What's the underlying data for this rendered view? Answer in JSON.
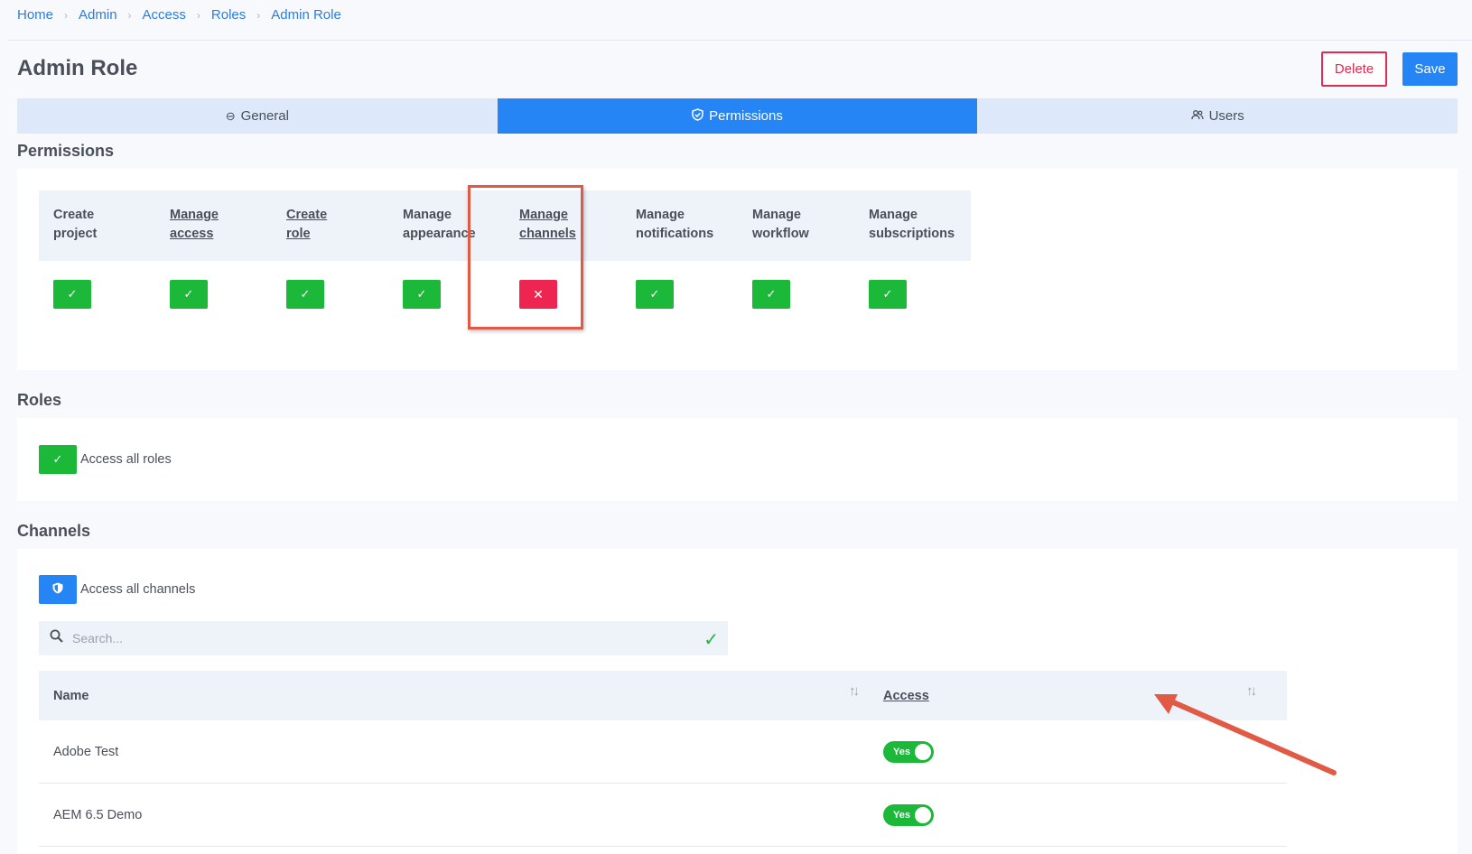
{
  "breadcrumb": [
    "Home",
    "Admin",
    "Access",
    "Roles",
    "Admin Role"
  ],
  "page_title": "Admin Role",
  "actions": {
    "delete_label": "Delete",
    "save_label": "Save"
  },
  "tabs": [
    {
      "label": "General",
      "icon": "minus-circle-icon"
    },
    {
      "label": "Permissions",
      "icon": "shield-check-icon",
      "active": true
    },
    {
      "label": "Users",
      "icon": "users-icon"
    }
  ],
  "permissions": {
    "title": "Permissions",
    "columns": [
      {
        "line1": "Create",
        "line2": "project",
        "linked": false,
        "granted": true
      },
      {
        "line1": "Manage",
        "line2": "access",
        "linked": true,
        "granted": true
      },
      {
        "line1": "Create",
        "line2": "role",
        "linked": true,
        "granted": true
      },
      {
        "line1": "Manage",
        "line2": "appearance",
        "linked": false,
        "granted": true
      },
      {
        "line1": "Manage",
        "line2": "channels",
        "linked": true,
        "granted": false
      },
      {
        "line1": "Manage",
        "line2": "notifications",
        "linked": false,
        "granted": true
      },
      {
        "line1": "Manage",
        "line2": "workflow",
        "linked": false,
        "granted": true
      },
      {
        "line1": "Manage",
        "line2": "subscriptions",
        "linked": false,
        "granted": true
      }
    ]
  },
  "roles": {
    "title": "Roles",
    "access_all_label": "Access all roles"
  },
  "channels": {
    "title": "Channels",
    "access_all_label": "Access all channels",
    "search_placeholder": "Search...",
    "columns": {
      "name": "Name",
      "access": "Access"
    },
    "rows": [
      {
        "name": "Adobe Test",
        "access": "Yes"
      },
      {
        "name": "AEM 6.5 Demo",
        "access": "Yes"
      }
    ]
  },
  "colors": {
    "primary": "#2685f5",
    "success": "#1cb83a",
    "danger": "#ee2451",
    "annotation": "#e05a45"
  }
}
